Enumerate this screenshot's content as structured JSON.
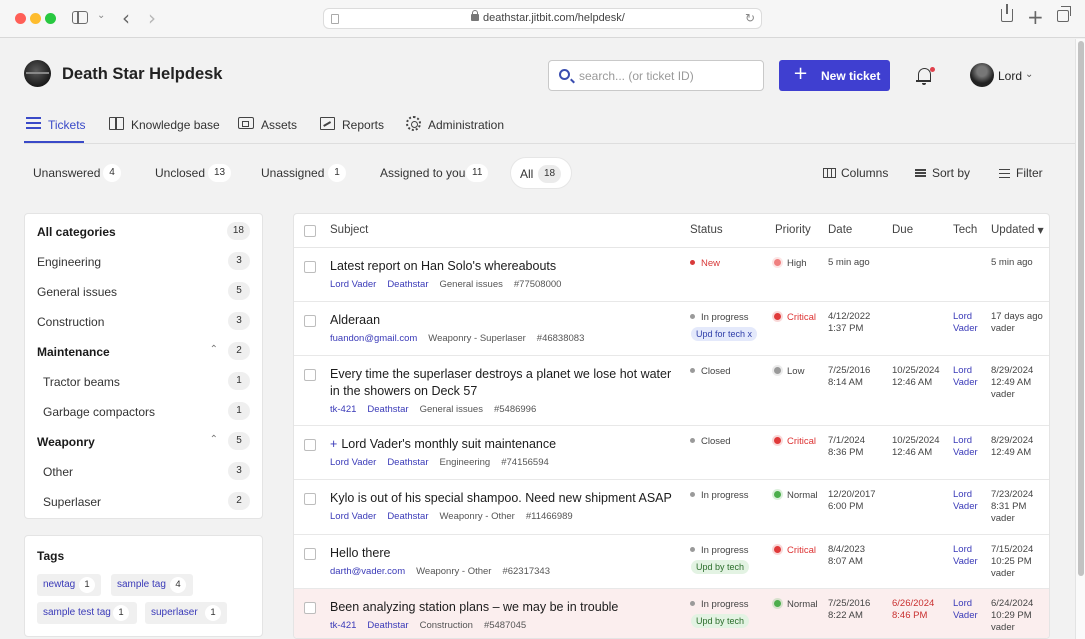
{
  "browser": {
    "url": "deathstar.jitbit.com/helpdesk/"
  },
  "header": {
    "app_title": "Death Star Helpdesk",
    "search_placeholder": "search... (or ticket ID)",
    "new_ticket_label": "New ticket",
    "new_ticket_icon": "+",
    "user_name": "Lord"
  },
  "nav": {
    "items": [
      {
        "label": "Tickets",
        "icon": "list-icon",
        "active": true
      },
      {
        "label": "Knowledge base",
        "icon": "book-icon"
      },
      {
        "label": "Assets",
        "icon": "assets-icon"
      },
      {
        "label": "Reports",
        "icon": "reports-icon"
      },
      {
        "label": "Administration",
        "icon": "gear-icon"
      }
    ]
  },
  "filters": {
    "tabs": [
      {
        "label": "Unanswered",
        "count": "4"
      },
      {
        "label": "Unclosed",
        "count": "13"
      },
      {
        "label": "Unassigned",
        "count": "1"
      },
      {
        "label": "Assigned to you",
        "count": "11"
      },
      {
        "label": "All",
        "count": "18",
        "active": true
      }
    ],
    "columns_label": "Columns",
    "sort_label": "Sort by",
    "filter_label": "Filter"
  },
  "categories": [
    {
      "label": "All categories",
      "count": "18",
      "bold": true
    },
    {
      "label": "Engineering",
      "count": "3"
    },
    {
      "label": "General issues",
      "count": "5"
    },
    {
      "label": "Construction",
      "count": "3"
    },
    {
      "label": "Maintenance",
      "count": "2",
      "bold": true,
      "expanded": true
    },
    {
      "label": "Tractor beams",
      "count": "1",
      "child": true
    },
    {
      "label": "Garbage compactors",
      "count": "1",
      "child": true
    },
    {
      "label": "Weaponry",
      "count": "5",
      "bold": true,
      "expanded": true
    },
    {
      "label": "Other",
      "count": "3",
      "child": true
    },
    {
      "label": "Superlaser",
      "count": "2",
      "child": true
    }
  ],
  "tags": {
    "title": "Tags",
    "items": [
      {
        "label": "newtag",
        "count": "1"
      },
      {
        "label": "sample tag",
        "count": "4"
      },
      {
        "label": "sample test tag",
        "count": "1"
      },
      {
        "label": "superlaser",
        "count": "1"
      }
    ]
  },
  "table": {
    "headers": {
      "subject": "Subject",
      "status": "Status",
      "priority": "Priority",
      "date": "Date",
      "due": "Due",
      "tech": "Tech",
      "updated": "Updated"
    },
    "rows": [
      {
        "subject": "Latest report on Han Solo's whereabouts",
        "meta": [
          "Lord Vader",
          "Deathstar",
          "General issues",
          "#77508000"
        ],
        "status": "New",
        "status_color": "#d83a3a",
        "priority": "High",
        "priority_color": "#f08080",
        "date": [
          "5 min ago"
        ],
        "due": [],
        "tech": [],
        "updated": [
          "5 min ago"
        ]
      },
      {
        "subject": "Alderaan",
        "meta": [
          "fuandon@gmail.com",
          "Weaponry - Superlaser",
          "#46838083"
        ],
        "status": "In progress",
        "status_color": "#9a9a9a",
        "status_tag": "Upd for tech x",
        "status_tag_color": "blue",
        "priority": "Critical",
        "priority_color": "#e03a3a",
        "date": [
          "4/12/2022",
          "1:37 PM"
        ],
        "due": [],
        "tech": [
          "Lord",
          "Vader"
        ],
        "updated": [
          "17 days ago",
          "vader"
        ]
      },
      {
        "subject": "Every time the superlaser destroys a planet we lose hot water in the showers on Deck 57",
        "meta": [
          "tk-421",
          "Deathstar",
          "General issues",
          "#5486996"
        ],
        "status": "Closed",
        "status_color": "#9a9a9a",
        "priority": "Low",
        "priority_color": "#9a9a9a",
        "date": [
          "7/25/2016",
          "8:14 AM"
        ],
        "due": [
          "10/25/2024",
          "12:46 AM"
        ],
        "tech": [
          "Lord",
          "Vader"
        ],
        "updated": [
          "8/29/2024",
          "12:49 AM",
          "vader"
        ]
      },
      {
        "subject": "Lord Vader's monthly suit maintenance",
        "subject_prefix": "+",
        "meta": [
          "Lord Vader",
          "Deathstar",
          "Engineering",
          "#74156594"
        ],
        "status": "Closed",
        "status_color": "#9a9a9a",
        "priority": "Critical",
        "priority_color": "#e03a3a",
        "date": [
          "7/1/2024",
          "8:36 PM"
        ],
        "due": [
          "10/25/2024",
          "12:46 AM"
        ],
        "tech": [
          "Lord",
          "Vader"
        ],
        "updated": [
          "8/29/2024",
          "12:49 AM"
        ]
      },
      {
        "subject": "Kylo is out of his special shampoo. Need new shipment ASAP",
        "meta": [
          "Lord Vader",
          "Deathstar",
          "Weaponry - Other",
          "#11466989"
        ],
        "status": "In progress",
        "status_color": "#9a9a9a",
        "priority": "Normal",
        "priority_color": "#4cae4c",
        "date": [
          "12/20/2017",
          "6:00 PM"
        ],
        "due": [],
        "tech": [
          "Lord",
          "Vader"
        ],
        "updated": [
          "7/23/2024",
          "8:31 PM",
          "vader"
        ]
      },
      {
        "subject": "Hello there",
        "meta": [
          "darth@vader.com",
          "Weaponry - Other",
          "#62317343"
        ],
        "status": "In progress",
        "status_color": "#9a9a9a",
        "status_tag": "Upd by tech",
        "status_tag_color": "green",
        "priority": "Critical",
        "priority_color": "#e03a3a",
        "date": [
          "8/4/2023",
          "8:07 AM"
        ],
        "due": [],
        "tech": [
          "Lord",
          "Vader"
        ],
        "updated": [
          "7/15/2024",
          "10:25 PM",
          "vader"
        ]
      },
      {
        "subject": "Been analyzing station plans – we may be in trouble",
        "meta": [
          "tk-421",
          "Deathstar",
          "Construction",
          "#5487045"
        ],
        "status": "In progress",
        "status_color": "#9a9a9a",
        "status_tag": "Upd by tech",
        "status_tag_color": "green",
        "priority": "Normal",
        "priority_color": "#4cae4c",
        "date": [
          "7/25/2016",
          "8:22 AM"
        ],
        "due": [
          "6/26/2024",
          "8:46 PM"
        ],
        "due_overdue": true,
        "tech": [
          "Lord",
          "Vader"
        ],
        "updated": [
          "6/24/2024",
          "10:29 PM",
          "vader"
        ],
        "highlight": true
      }
    ]
  }
}
